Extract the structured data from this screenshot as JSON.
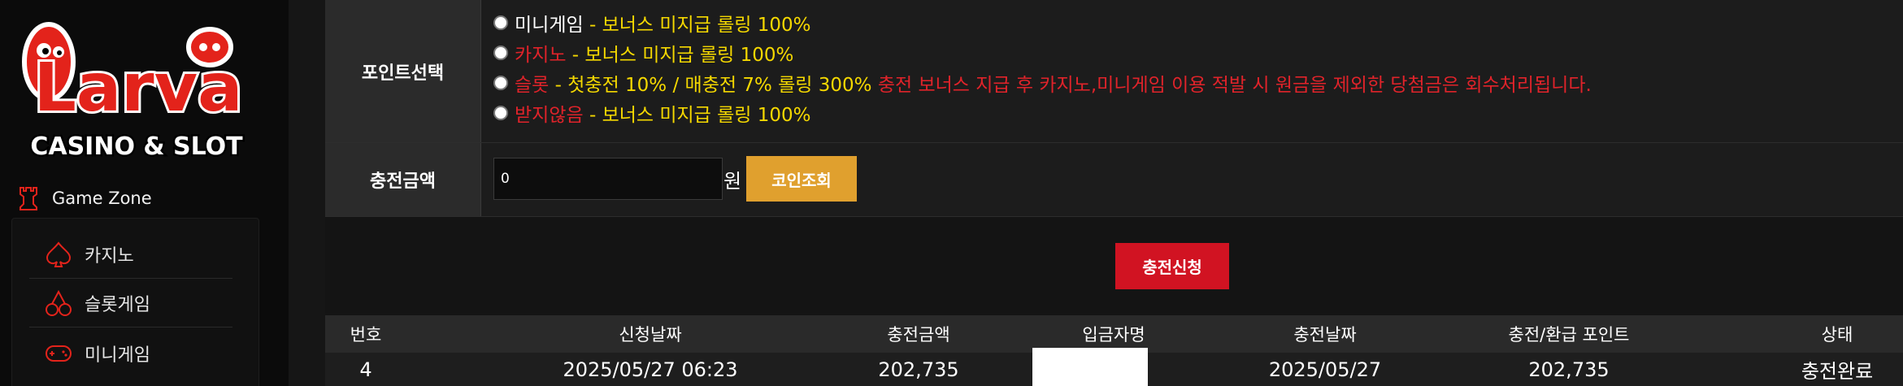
{
  "sidebar": {
    "logo": {
      "word": "Larva",
      "tagline": "CASINO & SLOT"
    },
    "zone_title": "Game Zone",
    "zone_icon": "chess-rook-icon",
    "items": [
      {
        "label": "카지노",
        "icon": "spade-icon"
      },
      {
        "label": "슬롯게임",
        "icon": "cherry-icon"
      },
      {
        "label": "미니게임",
        "icon": "gamepad-icon"
      }
    ]
  },
  "form": {
    "point_label": "포인트선택",
    "options": [
      {
        "name": "미니게임",
        "sep": " - ",
        "desc": "보너스 미지급 롤링 100%",
        "note": ""
      },
      {
        "name": "카지노",
        "sep": " - ",
        "desc": "보너스 미지급 롤링 100%",
        "note": ""
      },
      {
        "name": "슬롯",
        "sep": " - ",
        "desc": "첫충전 10% / 매충전 7% 롤링 300%",
        "note": "충전 보너스 지급 후 카지노,미니게임 이용 적발 시 원금을 제외한 당첨금은 회수처리됩니다."
      },
      {
        "name": "받지않음",
        "sep": " - ",
        "desc": "보너스 미지급 롤링 100%",
        "note": ""
      }
    ],
    "amount_label": "충전금액",
    "amount_value": "0",
    "currency": "원",
    "coin_button": "코인조회",
    "submit_button": "충전신청"
  },
  "table": {
    "headers": [
      "번호",
      "신청날짜",
      "충전금액",
      "입금자명",
      "충전날짜",
      "충전/환급 포인트",
      "상태"
    ],
    "rows": [
      [
        "4",
        "2025/05/27 06:23",
        "202,735",
        "",
        "2025/05/27",
        "202,735",
        "충전완료"
      ]
    ]
  },
  "colors": {
    "accent_yellow": "#f5d800",
    "accent_red": "#e0232a",
    "button_red": "#d11322",
    "button_orange": "#e0a02e"
  }
}
